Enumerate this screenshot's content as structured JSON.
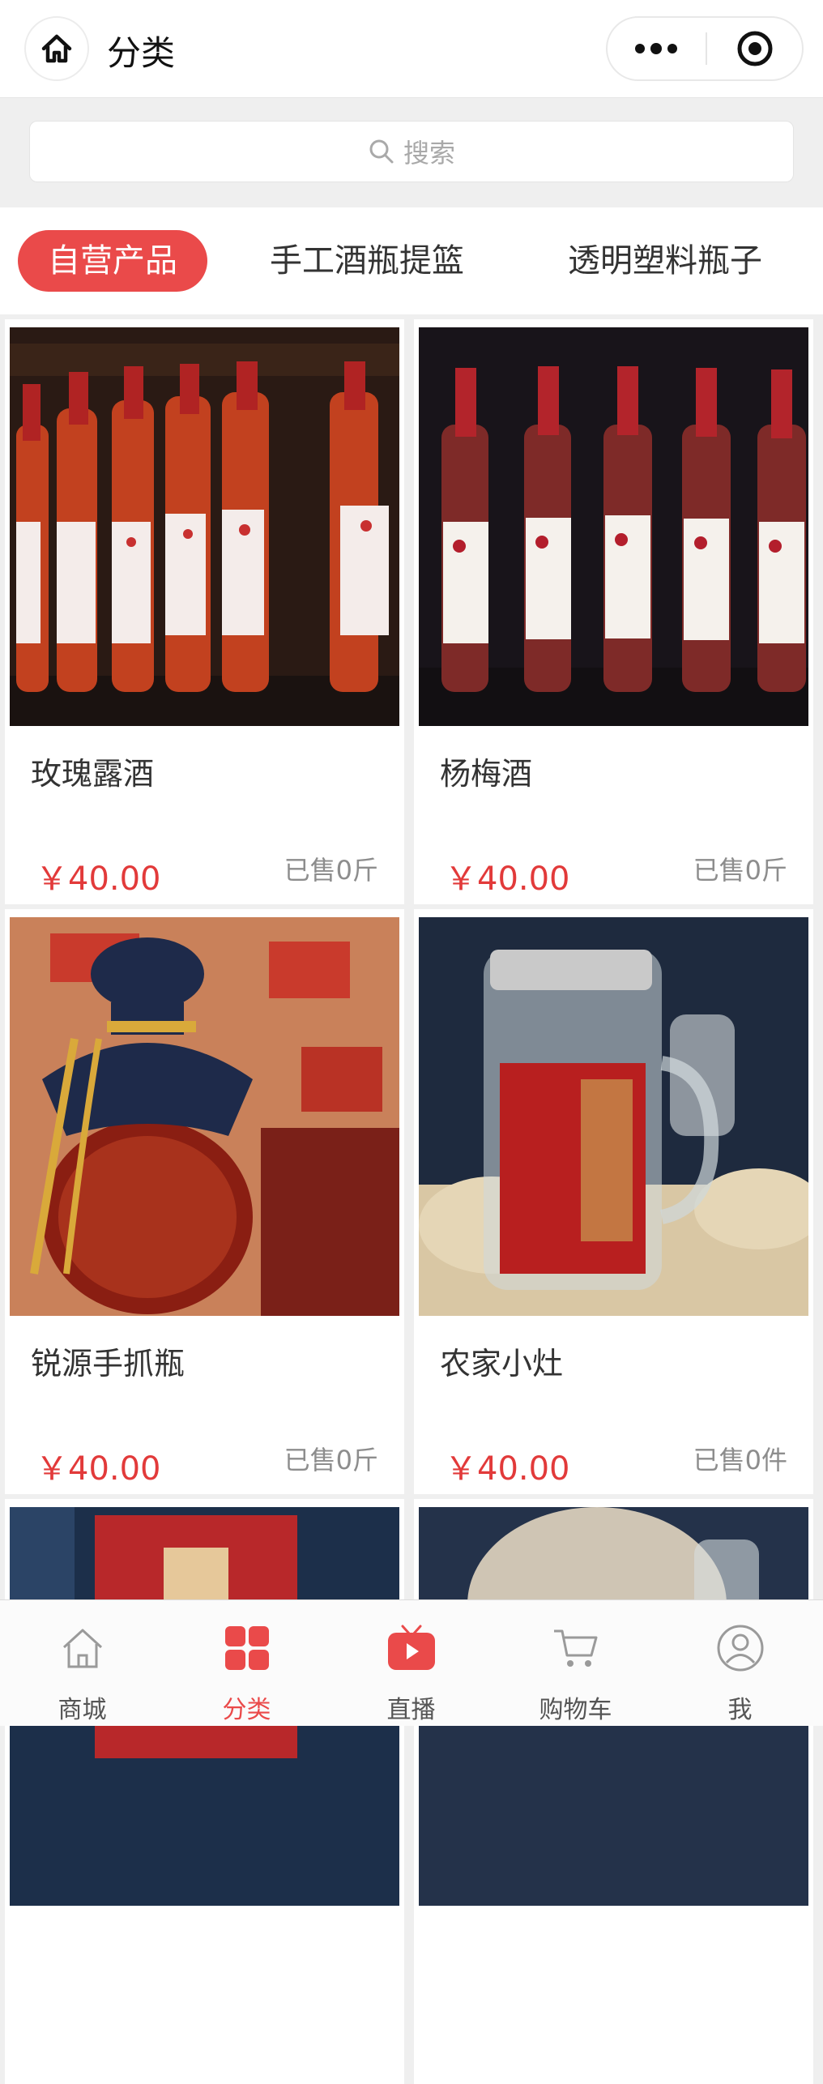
{
  "header": {
    "title": "分类"
  },
  "search": {
    "placeholder": "搜索"
  },
  "tabs": [
    {
      "label": "自营产品",
      "active": true
    },
    {
      "label": "手工酒瓶提篮",
      "active": false
    },
    {
      "label": "透明塑料瓶子",
      "active": false
    }
  ],
  "products": [
    {
      "name": "玫瑰露酒",
      "price": "￥40.00",
      "sold": "已售0斤",
      "image": "rose-wine-bottles-photo"
    },
    {
      "name": "杨梅酒",
      "price": "￥40.00",
      "sold": "已售0斤",
      "image": "bayberry-wine-bottles-photo"
    },
    {
      "name": "锐源手抓瓶",
      "price": "￥40.00",
      "sold": "已售0斤",
      "image": "ruiyuan-jar-photo"
    },
    {
      "name": "农家小灶",
      "price": "￥40.00",
      "sold": "已售0件",
      "image": "farmhouse-liquor-jar-photo"
    },
    {
      "name": "",
      "price": "",
      "sold": "",
      "image": "gift-box-photo-partial"
    },
    {
      "name": "",
      "price": "",
      "sold": "",
      "image": "clay-jar-photo-partial"
    }
  ],
  "tabbar": [
    {
      "label": "商城",
      "icon": "home-icon",
      "active": false
    },
    {
      "label": "分类",
      "icon": "category-grid-icon",
      "active": true
    },
    {
      "label": "直播",
      "icon": "live-tv-icon",
      "active": false
    },
    {
      "label": "购物车",
      "icon": "cart-icon",
      "active": false
    },
    {
      "label": "我",
      "icon": "user-icon",
      "active": false
    }
  ],
  "colors": {
    "accent": "#ea4a4a",
    "price": "#e23a3a",
    "background": "#efefef"
  }
}
